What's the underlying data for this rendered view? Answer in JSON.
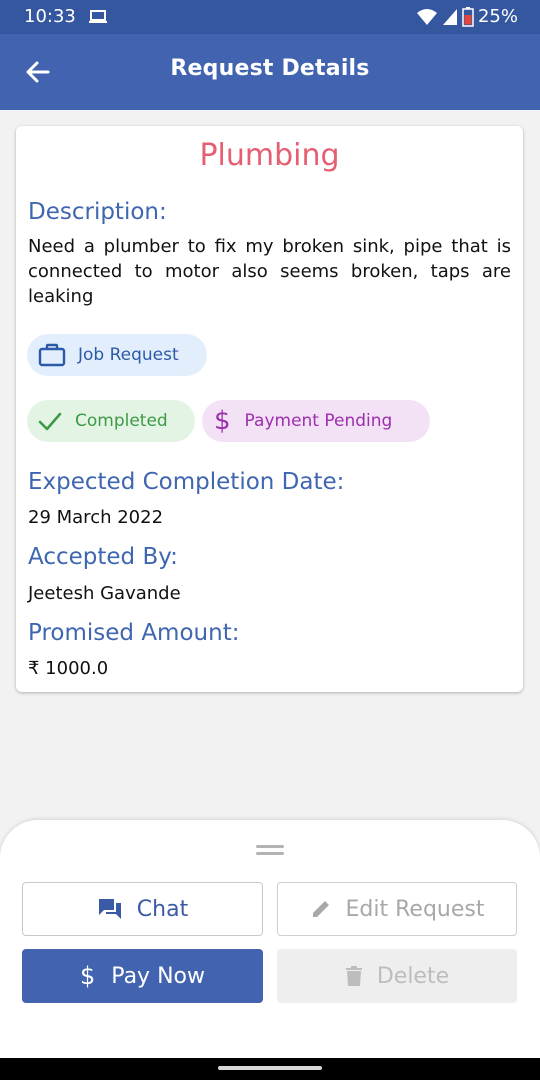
{
  "status": {
    "time": "10:33",
    "battery": "25%"
  },
  "appbar": {
    "title": "Request Details"
  },
  "request": {
    "title": "Plumbing",
    "description_label": "Description:",
    "description": "Need a plumber to fix my broken sink, pipe that is connected to motor also seems broken, taps are leaking",
    "type_chip": "Job Request",
    "status_chip": "Completed",
    "payment_chip": "Payment Pending",
    "completion_label": "Expected Completion Date:",
    "completion_date": "29 March 2022",
    "accepted_label": "Accepted By:",
    "accepted_by": "Jeetesh Gavande",
    "amount_label": "Promised Amount:",
    "amount": "₹ 1000.0"
  },
  "actions": {
    "chat": "Chat",
    "edit": "Edit Request",
    "pay": "Pay Now",
    "pay_icon": "$",
    "delete": "Delete"
  },
  "colors": {
    "primary": "#4264b0",
    "title": "#e55f73",
    "label": "#3f66b0",
    "completed": "#3d9a45",
    "payment": "#9c2fae"
  },
  "icons": [
    "back-arrow-icon",
    "laptop-icon",
    "wifi-icon",
    "signal-icon",
    "battery-icon",
    "briefcase-icon",
    "check-icon",
    "dollar-icon",
    "chat-icon",
    "pencil-icon",
    "trash-icon"
  ]
}
